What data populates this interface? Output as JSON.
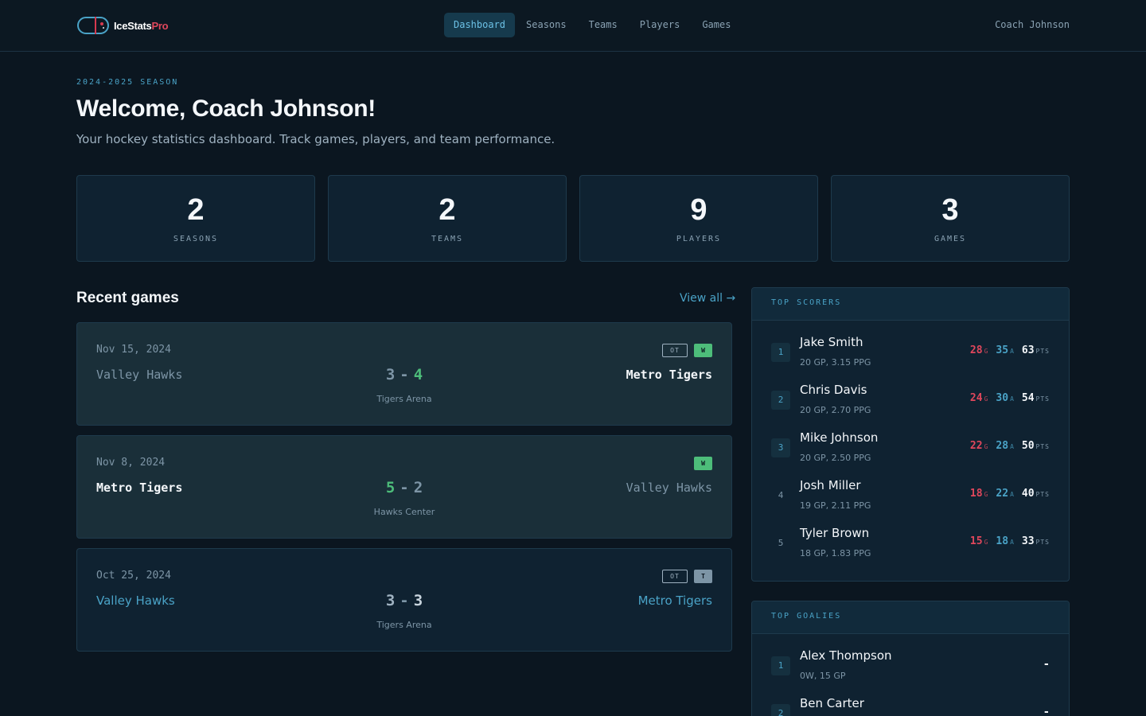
{
  "app": {
    "name": "IceStats",
    "badge": "Pro"
  },
  "nav": {
    "items": [
      {
        "label": "Dashboard"
      },
      {
        "label": "Seasons"
      },
      {
        "label": "Teams"
      },
      {
        "label": "Players"
      },
      {
        "label": "Games"
      }
    ],
    "active": "Dashboard",
    "user": "Coach Johnson"
  },
  "header": {
    "season": "2024-2025 SEASON",
    "title": "Welcome, Coach Johnson!",
    "subtitle": "Your hockey statistics dashboard. Track games, players, and team performance."
  },
  "stats": [
    {
      "value": "2",
      "label": "SEASONS"
    },
    {
      "value": "2",
      "label": "TEAMS"
    },
    {
      "value": "9",
      "label": "PLAYERS"
    },
    {
      "value": "3",
      "label": "GAMES"
    }
  ],
  "recent_games": {
    "title": "Recent games",
    "view_all": "View all →",
    "games": [
      {
        "date": "Nov 15, 2024",
        "home": "Valley Hawks",
        "away": "Metro Tigers",
        "home_score": "3",
        "away_score": "4",
        "venue": "Tigers Arena",
        "ot": "OT",
        "result": "W"
      },
      {
        "date": "Nov 8, 2024",
        "home": "Metro Tigers",
        "away": "Valley Hawks",
        "home_score": "5",
        "away_score": "2",
        "venue": "Hawks Center",
        "result": "W"
      },
      {
        "date": "Oct 25, 2024",
        "home": "Valley Hawks",
        "away": "Metro Tigers",
        "home_score": "3",
        "away_score": "3",
        "venue": "Tigers Arena",
        "ot": "OT",
        "result": "T"
      }
    ],
    "score_dash": "-"
  },
  "top_scorers": {
    "title": "TOP SCORERS",
    "suffix_g": "G",
    "suffix_a": "A",
    "suffix_p": "PTS",
    "players": [
      {
        "rank": "1",
        "name": "Jake Smith",
        "meta": "20 GP, 3.15 PPG",
        "g": "28",
        "a": "35",
        "p": "63"
      },
      {
        "rank": "2",
        "name": "Chris Davis",
        "meta": "20 GP, 2.70 PPG",
        "g": "24",
        "a": "30",
        "p": "54"
      },
      {
        "rank": "3",
        "name": "Mike Johnson",
        "meta": "20 GP, 2.50 PPG",
        "g": "22",
        "a": "28",
        "p": "50"
      },
      {
        "rank": "4",
        "name": "Josh Miller",
        "meta": "19 GP, 2.11 PPG",
        "g": "18",
        "a": "22",
        "p": "40"
      },
      {
        "rank": "5",
        "name": "Tyler Brown",
        "meta": "18 GP, 1.83 PPG",
        "g": "15",
        "a": "18",
        "p": "33"
      }
    ]
  },
  "top_goalies": {
    "title": "TOP GOALIES",
    "goalies": [
      {
        "rank": "1",
        "name": "Alex Thompson",
        "meta": "0W, 15 GP",
        "stat": "-"
      },
      {
        "rank": "2",
        "name": "Ben Carter",
        "meta": "",
        "stat": "-"
      }
    ]
  }
}
